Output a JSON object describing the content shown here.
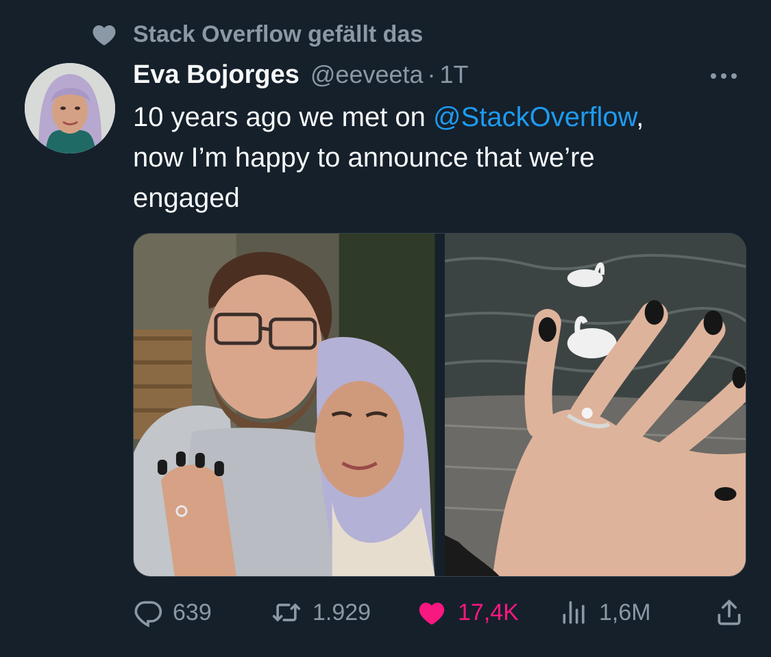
{
  "social_context": {
    "text": "Stack Overflow gefällt das",
    "icon": "heart-icon"
  },
  "author": {
    "display_name": "Eva Bojorges",
    "handle": "@eeveeta",
    "separator": "·",
    "time": "1T"
  },
  "tweet": {
    "line1_prefix": "10 years ago we met on ",
    "mention": "@StackOverflow",
    "line1_suffix": ",",
    "line2": "now I’m happy to announce that we’re",
    "line3": "engaged"
  },
  "media": [
    {
      "icon": "couple-selfie-photo"
    },
    {
      "icon": "engagement-ring-hand-photo"
    }
  ],
  "actions": {
    "replies": "639",
    "retweets": "1.929",
    "likes": "17,4K",
    "views": "1,6M"
  },
  "colors": {
    "background": "#15202b",
    "secondary_text": "#8b98a5",
    "link": "#1d9bf0",
    "like": "#f91880"
  }
}
